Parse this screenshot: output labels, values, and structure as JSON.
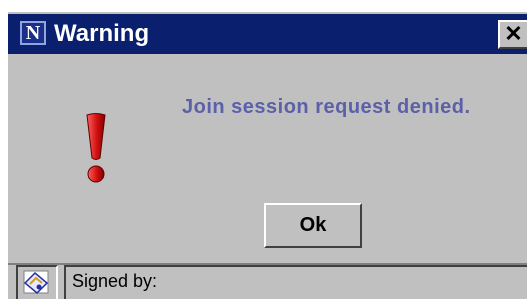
{
  "window": {
    "title": "Warning",
    "close_symbol": "✕",
    "app_icon_letter": "N",
    "app_icon": "netscape-n-icon"
  },
  "dialog": {
    "icon": "exclamation-icon",
    "message": "Join session request denied.",
    "ok_label": "Ok"
  },
  "statusbar": {
    "icon": "signed-certificate-icon",
    "text": "Signed by:"
  },
  "colors": {
    "titlebar": "#0a1f6e",
    "dialog_bg": "#c0c0c0",
    "message": "#5c60a8",
    "exclamation": "#cc1111"
  }
}
